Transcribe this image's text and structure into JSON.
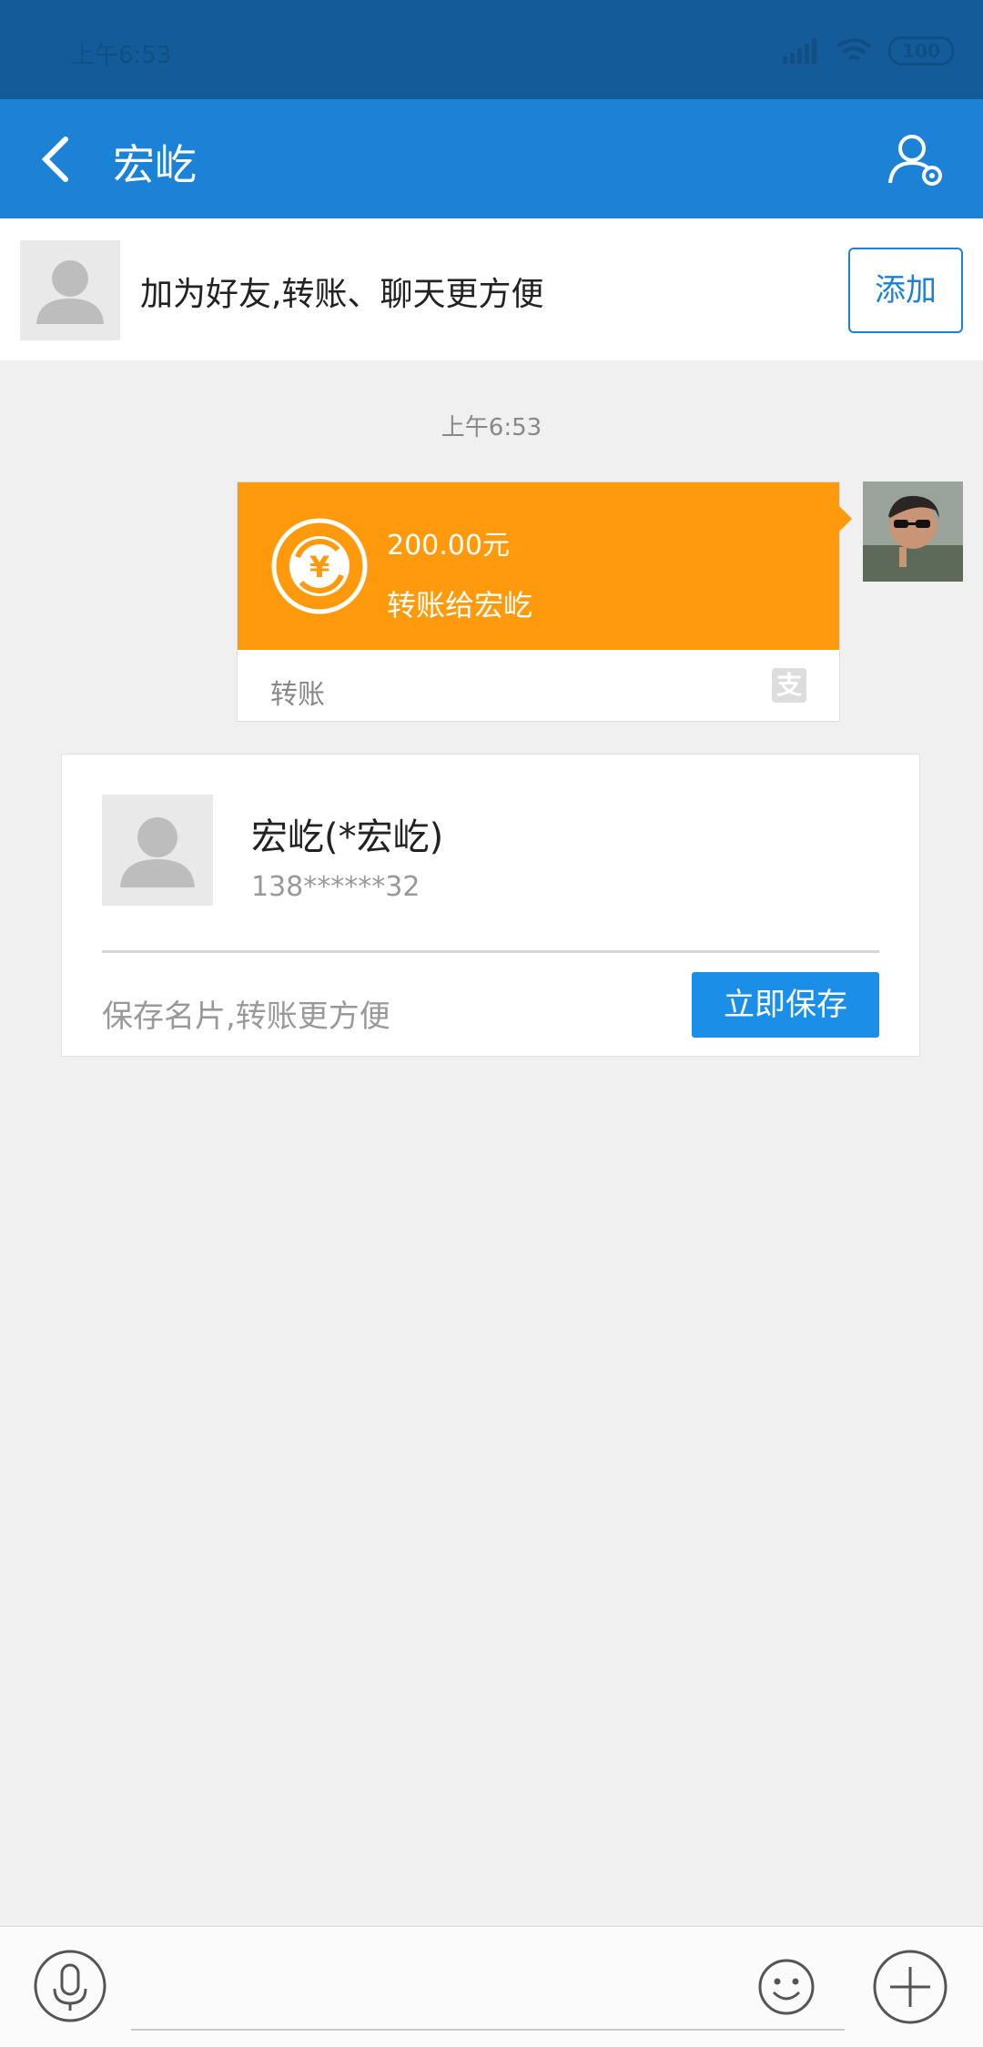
{
  "status_bar": {
    "time": "上午6:53",
    "battery": "100"
  },
  "header": {
    "title": "宏屹"
  },
  "banner": {
    "text": "加为好友,转账、聊天更方便",
    "add_label": "添加"
  },
  "chat": {
    "time_label": "上午6:53",
    "transfer": {
      "amount": "200.00元",
      "description": "转账给宏屹",
      "footer_label": "转账",
      "footer_icon": "支"
    }
  },
  "card": {
    "name": "宏屹(*宏屹)",
    "phone": "138******32",
    "hint": "保存名片,转账更方便",
    "save_label": "立即保存"
  },
  "input": {
    "placeholder": ""
  },
  "colors": {
    "header": "#1b82d6",
    "status_bar": "#145c99",
    "transfer_orange": "#fe9a0b",
    "button_blue": "#1b8ee8"
  }
}
